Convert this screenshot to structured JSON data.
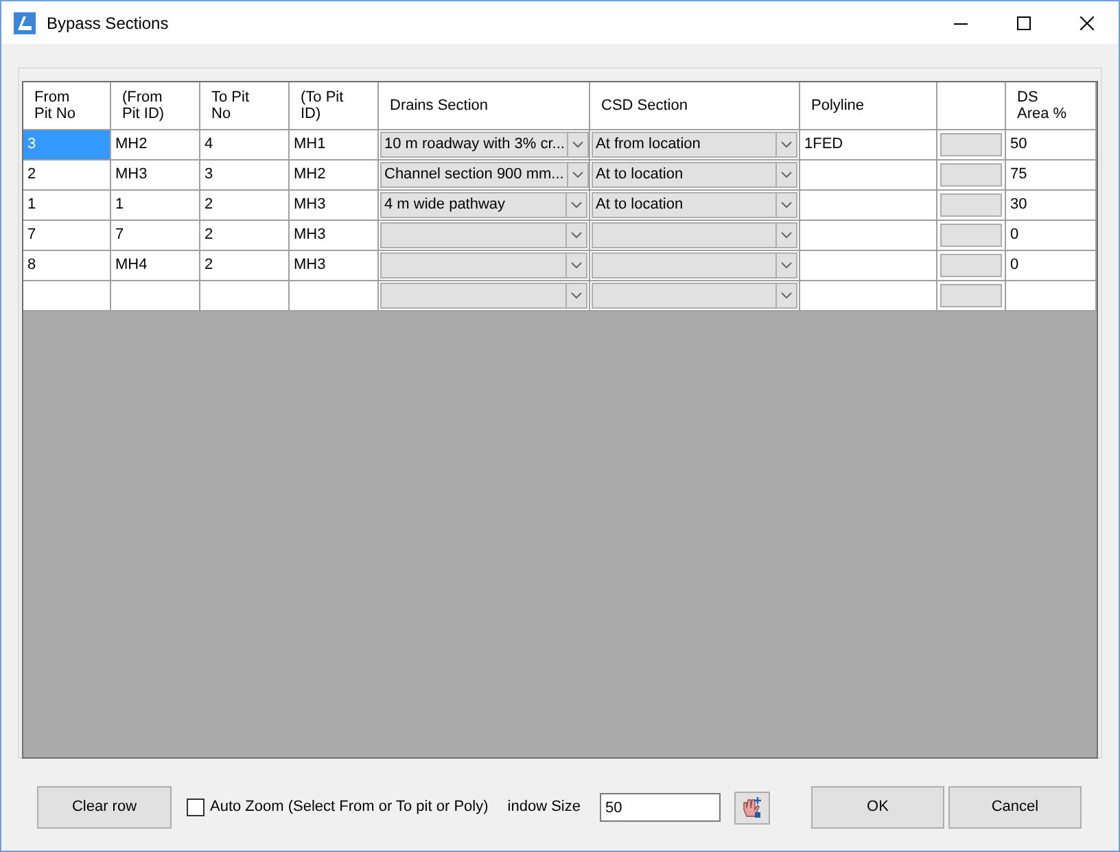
{
  "window": {
    "title": "Bypass Sections"
  },
  "table": {
    "columns": [
      "From\nPit No",
      "(From\nPit ID)",
      "To Pit\nNo",
      "(To Pit\nID)",
      "Drains Section",
      "CSD Section",
      "Polyline",
      "DS\nArea %"
    ],
    "rows": [
      {
        "from_pit_no": "3",
        "from_pit_id": "MH2",
        "to_pit_no": "4",
        "to_pit_id": "MH1",
        "drains_section": "10 m roadway with 3% cr...",
        "csd_section": "At from location",
        "polyline": "1FED",
        "ds_area": "50",
        "selected": true
      },
      {
        "from_pit_no": "2",
        "from_pit_id": "MH3",
        "to_pit_no": "3",
        "to_pit_id": "MH2",
        "drains_section": "Channel section 900 mm...",
        "csd_section": "At to location",
        "polyline": "",
        "ds_area": "75",
        "selected": false
      },
      {
        "from_pit_no": "1",
        "from_pit_id": "1",
        "to_pit_no": "2",
        "to_pit_id": "MH3",
        "drains_section": "4 m wide pathway",
        "csd_section": "At to location",
        "polyline": "",
        "ds_area": "30",
        "selected": false
      },
      {
        "from_pit_no": "7",
        "from_pit_id": "7",
        "to_pit_no": "2",
        "to_pit_id": "MH3",
        "drains_section": "",
        "csd_section": "",
        "polyline": "",
        "ds_area": "0",
        "selected": false
      },
      {
        "from_pit_no": "8",
        "from_pit_id": "MH4",
        "to_pit_no": "2",
        "to_pit_id": "MH3",
        "drains_section": "",
        "csd_section": "",
        "polyline": "",
        "ds_area": "0",
        "selected": false
      },
      {
        "from_pit_no": "",
        "from_pit_id": "",
        "to_pit_no": "",
        "to_pit_id": "",
        "drains_section": "",
        "csd_section": "",
        "polyline": "",
        "ds_area": "",
        "selected": false
      }
    ]
  },
  "footer": {
    "clear_button": "Clear row",
    "auto_zoom": {
      "label": "Auto Zoom (Select From or To pit or Poly)",
      "checked": false
    },
    "window_size_label": "indow Size",
    "window_size_value": "50",
    "ok_button": "OK",
    "cancel_button": "Cancel"
  }
}
